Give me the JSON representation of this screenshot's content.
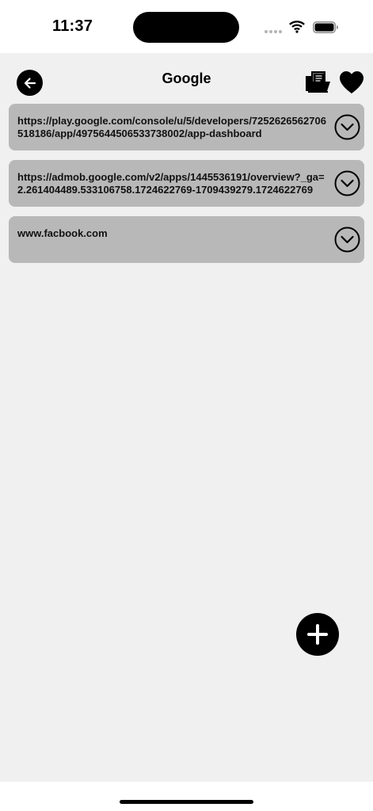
{
  "status_bar": {
    "time": "11:37"
  },
  "header": {
    "title": "Google"
  },
  "links": [
    {
      "url": "https://play.google.com/console/u/5/developers/7252626562706518186/app/4975644506533738002/app-dashboard"
    },
    {
      "url": "https://admob.google.com/v2/apps/1445536191/overview?_ga=2.261404489.533106758.1724622769-1709439279.1724622769"
    },
    {
      "url": "www.facbook.com"
    }
  ],
  "icons": {
    "back": "arrow-left-icon",
    "folder": "folder-documents-icon",
    "favorite": "heart-icon",
    "expand": "chevron-down-circle-icon",
    "add": "plus-icon"
  },
  "colors": {
    "background": "#f0f0f0",
    "card": "#b8b8b8",
    "accent": "#000000"
  }
}
